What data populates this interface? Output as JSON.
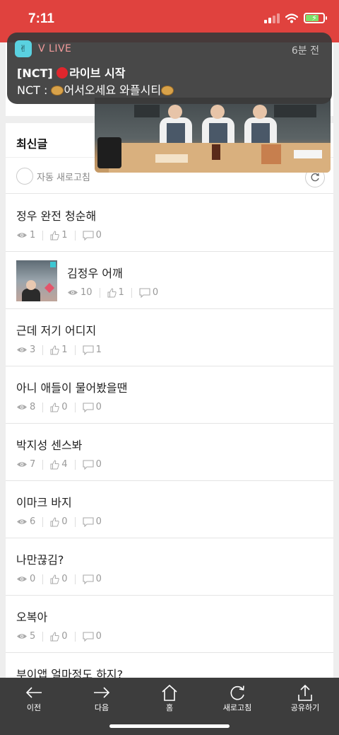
{
  "status_bar": {
    "time": "7:11"
  },
  "notification": {
    "app_name": "V LIVE",
    "time_ago": "6분 전",
    "line1": "[NCT] 🔴라이브 시작",
    "line1_prefix": "[NCT]",
    "line1_text": "라이브 시작",
    "line2_prefix": "NCT :",
    "line2_text": "어서오세요 와플시티"
  },
  "latest": {
    "title": "최신글",
    "auto_refresh_label": "자동 새로고침",
    "posts": [
      {
        "title": "정우 완전 청순해",
        "views": "1",
        "likes": "1",
        "comments": "0",
        "thumb": false
      },
      {
        "title": "김정우 어깨",
        "views": "10",
        "likes": "1",
        "comments": "0",
        "thumb": true
      },
      {
        "title": "근데 저기 어디지",
        "views": "3",
        "likes": "1",
        "comments": "1",
        "thumb": false
      },
      {
        "title": "아니 애들이 물어봤을땐",
        "views": "8",
        "likes": "0",
        "comments": "0",
        "thumb": false
      },
      {
        "title": "박지성 센스봐",
        "views": "7",
        "likes": "4",
        "comments": "0",
        "thumb": false
      },
      {
        "title": "이마크 바지",
        "views": "6",
        "likes": "0",
        "comments": "0",
        "thumb": false
      },
      {
        "title": "나만끊김?",
        "views": "0",
        "likes": "0",
        "comments": "0",
        "thumb": false
      },
      {
        "title": "오복아",
        "views": "5",
        "likes": "0",
        "comments": "0",
        "thumb": false
      },
      {
        "title": "부이앱 얼마정도 하지?",
        "views": "",
        "likes": "",
        "comments": "",
        "thumb": false
      }
    ]
  },
  "toolbar": {
    "back": "이전",
    "next": "다음",
    "home": "홈",
    "refresh": "새로고침",
    "share": "공유하기"
  },
  "colors": {
    "status_bar": "#e0423e",
    "notification_bg": "#3a3a3a",
    "app_name": "#f29a9a",
    "toolbar_bg": "#3d3d3d"
  }
}
